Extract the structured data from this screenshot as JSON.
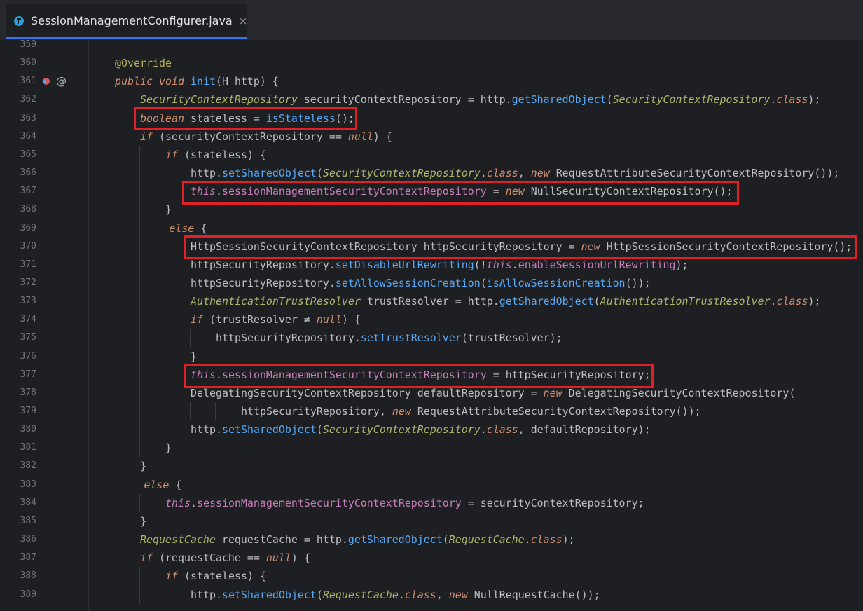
{
  "tab": {
    "label": "SessionManagementConfigurer.java",
    "close": "×",
    "icon": "java-class-icon"
  },
  "reader_hint": "Re",
  "lines": [
    {
      "num": "359",
      "text": ""
    },
    {
      "num": "360",
      "text": "@Override"
    },
    {
      "num": "361",
      "text": "public void init(H http) {"
    },
    {
      "num": "362",
      "text": "SecurityContextRepository securityContextRepository = http.getSharedObject(SecurityContextRepository.class);"
    },
    {
      "num": "363",
      "text": "boolean stateless = isStateless();"
    },
    {
      "num": "364",
      "text": "if (securityContextRepository == null) {"
    },
    {
      "num": "365",
      "text": "if (stateless) {"
    },
    {
      "num": "366",
      "text": "http.setSharedObject(SecurityContextRepository.class, new RequestAttributeSecurityContextRepository());"
    },
    {
      "num": "367",
      "text": "this.sessionManagementSecurityContextRepository = new NullSecurityContextRepository();"
    },
    {
      "num": "368",
      "text": "}"
    },
    {
      "num": "369",
      "text": "else {"
    },
    {
      "num": "370",
      "text": "HttpSessionSecurityContextRepository httpSecurityRepository = new HttpSessionSecurityContextRepository();"
    },
    {
      "num": "371",
      "text": "httpSecurityRepository.setDisableUrlRewriting(!this.enableSessionUrlRewriting);"
    },
    {
      "num": "372",
      "text": "httpSecurityRepository.setAllowSessionCreation(isAllowSessionCreation());"
    },
    {
      "num": "373",
      "text": "AuthenticationTrustResolver trustResolver = http.getSharedObject(AuthenticationTrustResolver.class);"
    },
    {
      "num": "374",
      "text": "if (trustResolver ≠ null) {"
    },
    {
      "num": "375",
      "text": "httpSecurityRepository.setTrustResolver(trustResolver);"
    },
    {
      "num": "376",
      "text": "}"
    },
    {
      "num": "377",
      "text": "this.sessionManagementSecurityContextRepository = httpSecurityRepository;"
    },
    {
      "num": "378",
      "text": "DelegatingSecurityContextRepository defaultRepository = new DelegatingSecurityContextRepository("
    },
    {
      "num": "379",
      "text": "httpSecurityRepository, new RequestAttributeSecurityContextRepository());"
    },
    {
      "num": "380",
      "text": "http.setSharedObject(SecurityContextRepository.class, defaultRepository);"
    },
    {
      "num": "381",
      "text": "}"
    },
    {
      "num": "382",
      "text": "}"
    },
    {
      "num": "383",
      "text": "else {"
    },
    {
      "num": "384",
      "text": "this.sessionManagementSecurityContextRepository = securityContextRepository;"
    },
    {
      "num": "385",
      "text": "}"
    },
    {
      "num": "386",
      "text": "RequestCache requestCache = http.getSharedObject(RequestCache.class);"
    },
    {
      "num": "387",
      "text": "if (requestCache == null) {"
    },
    {
      "num": "388",
      "text": "if (stateless) {"
    },
    {
      "num": "389",
      "text": "http.setSharedObject(RequestCache.class, new NullRequestCache());"
    }
  ],
  "gutter": {
    "override_icon": "override-method-icon",
    "annotation_marker": "@"
  },
  "colors": {
    "background": "#1e1f22",
    "keyword": "#cf8e6d",
    "field": "#c77dba",
    "method": "#56a8f5",
    "interface": "#a9b76b",
    "annotation": "#b3ae60",
    "highlight_box": "#e01f26"
  }
}
